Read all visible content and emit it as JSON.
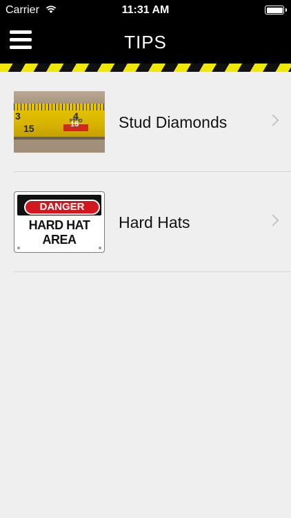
{
  "status_bar": {
    "carrier": "Carrier",
    "time": "11:31 AM"
  },
  "nav": {
    "title": "TIPS"
  },
  "items": [
    {
      "label": "Stud Diamonds",
      "thumb": {
        "numbers": [
          "3",
          "4",
          "15",
          "16"
        ],
        "marker": "STUD"
      }
    },
    {
      "label": "Hard Hats",
      "thumb": {
        "header": "DANGER",
        "line1": "HARD HAT",
        "line2": "AREA"
      }
    }
  ],
  "colors": {
    "nav_background": "#000000",
    "stripe_yellow": "#f0e800",
    "list_background": "#efefef",
    "danger_red": "#d0181e"
  }
}
